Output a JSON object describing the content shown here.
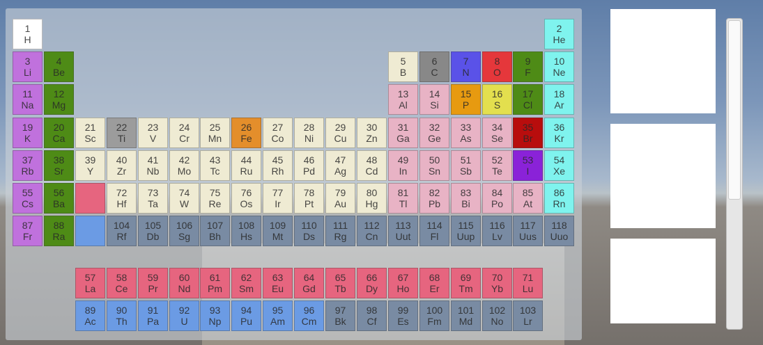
{
  "colors": {
    "nonmetal": "#ffffff",
    "noble": "#7ff3ee",
    "alkali": "#c071dd",
    "alkaline": "#4e8b16",
    "transition": "#efebd3",
    "post_transition": "#e8b3c5",
    "metalloid": "#efebd3",
    "lanthanide": "#e6657f",
    "actinide": "#6b9be4",
    "unknown": "#798ba3",
    "carbon": "#888888",
    "titanium": "#9c9c9c",
    "nitrogen": "#5a52e8",
    "oxygen": "#e5373b",
    "fluorine": "#4e8b16",
    "chlorine": "#4e8b16",
    "phosphorus": "#e79a10",
    "sulfur": "#e3df4e",
    "iron": "#e48e2b",
    "bromine": "#b80d0d",
    "iodine": "#8a22d8"
  },
  "elements": [
    {
      "n": "1",
      "s": "H",
      "r": 1,
      "c": 1,
      "k": "nonmetal"
    },
    {
      "n": "2",
      "s": "He",
      "r": 1,
      "c": 18,
      "k": "noble"
    },
    {
      "n": "3",
      "s": "Li",
      "r": 2,
      "c": 1,
      "k": "alkali"
    },
    {
      "n": "4",
      "s": "Be",
      "r": 2,
      "c": 2,
      "k": "alkaline"
    },
    {
      "n": "5",
      "s": "B",
      "r": 2,
      "c": 13,
      "k": "metalloid"
    },
    {
      "n": "6",
      "s": "C",
      "r": 2,
      "c": 14,
      "k": "carbon"
    },
    {
      "n": "7",
      "s": "N",
      "r": 2,
      "c": 15,
      "k": "nitrogen"
    },
    {
      "n": "8",
      "s": "O",
      "r": 2,
      "c": 16,
      "k": "oxygen"
    },
    {
      "n": "9",
      "s": "F",
      "r": 2,
      "c": 17,
      "k": "fluorine"
    },
    {
      "n": "10",
      "s": "Ne",
      "r": 2,
      "c": 18,
      "k": "noble"
    },
    {
      "n": "11",
      "s": "Na",
      "r": 3,
      "c": 1,
      "k": "alkali"
    },
    {
      "n": "12",
      "s": "Mg",
      "r": 3,
      "c": 2,
      "k": "alkaline"
    },
    {
      "n": "13",
      "s": "Al",
      "r": 3,
      "c": 13,
      "k": "post_transition"
    },
    {
      "n": "14",
      "s": "Si",
      "r": 3,
      "c": 14,
      "k": "post_transition"
    },
    {
      "n": "15",
      "s": "P",
      "r": 3,
      "c": 15,
      "k": "phosphorus"
    },
    {
      "n": "16",
      "s": "S",
      "r": 3,
      "c": 16,
      "k": "sulfur"
    },
    {
      "n": "17",
      "s": "Cl",
      "r": 3,
      "c": 17,
      "k": "chlorine"
    },
    {
      "n": "18",
      "s": "Ar",
      "r": 3,
      "c": 18,
      "k": "noble"
    },
    {
      "n": "19",
      "s": "K",
      "r": 4,
      "c": 1,
      "k": "alkali"
    },
    {
      "n": "20",
      "s": "Ca",
      "r": 4,
      "c": 2,
      "k": "alkaline"
    },
    {
      "n": "21",
      "s": "Sc",
      "r": 4,
      "c": 3,
      "k": "transition"
    },
    {
      "n": "22",
      "s": "Ti",
      "r": 4,
      "c": 4,
      "k": "titanium"
    },
    {
      "n": "23",
      "s": "V",
      "r": 4,
      "c": 5,
      "k": "transition"
    },
    {
      "n": "24",
      "s": "Cr",
      "r": 4,
      "c": 6,
      "k": "transition"
    },
    {
      "n": "25",
      "s": "Mn",
      "r": 4,
      "c": 7,
      "k": "transition"
    },
    {
      "n": "26",
      "s": "Fe",
      "r": 4,
      "c": 8,
      "k": "iron"
    },
    {
      "n": "27",
      "s": "Co",
      "r": 4,
      "c": 9,
      "k": "transition"
    },
    {
      "n": "28",
      "s": "Ni",
      "r": 4,
      "c": 10,
      "k": "transition"
    },
    {
      "n": "29",
      "s": "Cu",
      "r": 4,
      "c": 11,
      "k": "transition"
    },
    {
      "n": "30",
      "s": "Zn",
      "r": 4,
      "c": 12,
      "k": "transition"
    },
    {
      "n": "31",
      "s": "Ga",
      "r": 4,
      "c": 13,
      "k": "post_transition"
    },
    {
      "n": "32",
      "s": "Ge",
      "r": 4,
      "c": 14,
      "k": "post_transition"
    },
    {
      "n": "33",
      "s": "As",
      "r": 4,
      "c": 15,
      "k": "post_transition"
    },
    {
      "n": "34",
      "s": "Se",
      "r": 4,
      "c": 16,
      "k": "post_transition"
    },
    {
      "n": "35",
      "s": "Br",
      "r": 4,
      "c": 17,
      "k": "bromine"
    },
    {
      "n": "36",
      "s": "Kr",
      "r": 4,
      "c": 18,
      "k": "noble"
    },
    {
      "n": "37",
      "s": "Rb",
      "r": 5,
      "c": 1,
      "k": "alkali"
    },
    {
      "n": "38",
      "s": "Sr",
      "r": 5,
      "c": 2,
      "k": "alkaline"
    },
    {
      "n": "39",
      "s": "Y",
      "r": 5,
      "c": 3,
      "k": "transition"
    },
    {
      "n": "40",
      "s": "Zr",
      "r": 5,
      "c": 4,
      "k": "transition"
    },
    {
      "n": "41",
      "s": "Nb",
      "r": 5,
      "c": 5,
      "k": "transition"
    },
    {
      "n": "42",
      "s": "Mo",
      "r": 5,
      "c": 6,
      "k": "transition"
    },
    {
      "n": "43",
      "s": "Tc",
      "r": 5,
      "c": 7,
      "k": "transition"
    },
    {
      "n": "44",
      "s": "Ru",
      "r": 5,
      "c": 8,
      "k": "transition"
    },
    {
      "n": "45",
      "s": "Rh",
      "r": 5,
      "c": 9,
      "k": "transition"
    },
    {
      "n": "46",
      "s": "Pd",
      "r": 5,
      "c": 10,
      "k": "transition"
    },
    {
      "n": "47",
      "s": "Ag",
      "r": 5,
      "c": 11,
      "k": "transition"
    },
    {
      "n": "48",
      "s": "Cd",
      "r": 5,
      "c": 12,
      "k": "transition"
    },
    {
      "n": "49",
      "s": "In",
      "r": 5,
      "c": 13,
      "k": "post_transition"
    },
    {
      "n": "50",
      "s": "Sn",
      "r": 5,
      "c": 14,
      "k": "post_transition"
    },
    {
      "n": "51",
      "s": "Sb",
      "r": 5,
      "c": 15,
      "k": "post_transition"
    },
    {
      "n": "52",
      "s": "Te",
      "r": 5,
      "c": 16,
      "k": "post_transition"
    },
    {
      "n": "53",
      "s": "I",
      "r": 5,
      "c": 17,
      "k": "iodine"
    },
    {
      "n": "54",
      "s": "Xe",
      "r": 5,
      "c": 18,
      "k": "noble"
    },
    {
      "n": "55",
      "s": "Cs",
      "r": 6,
      "c": 1,
      "k": "alkali"
    },
    {
      "n": "56",
      "s": "Ba",
      "r": 6,
      "c": 2,
      "k": "alkaline"
    },
    {
      "n": "",
      "s": "",
      "r": 6,
      "c": 3,
      "k": "lanthanide"
    },
    {
      "n": "72",
      "s": "Hf",
      "r": 6,
      "c": 4,
      "k": "transition"
    },
    {
      "n": "73",
      "s": "Ta",
      "r": 6,
      "c": 5,
      "k": "transition"
    },
    {
      "n": "74",
      "s": "W",
      "r": 6,
      "c": 6,
      "k": "transition"
    },
    {
      "n": "75",
      "s": "Re",
      "r": 6,
      "c": 7,
      "k": "transition"
    },
    {
      "n": "76",
      "s": "Os",
      "r": 6,
      "c": 8,
      "k": "transition"
    },
    {
      "n": "77",
      "s": "Ir",
      "r": 6,
      "c": 9,
      "k": "transition"
    },
    {
      "n": "78",
      "s": "Pt",
      "r": 6,
      "c": 10,
      "k": "transition"
    },
    {
      "n": "79",
      "s": "Au",
      "r": 6,
      "c": 11,
      "k": "transition"
    },
    {
      "n": "80",
      "s": "Hg",
      "r": 6,
      "c": 12,
      "k": "transition"
    },
    {
      "n": "81",
      "s": "Tl",
      "r": 6,
      "c": 13,
      "k": "post_transition"
    },
    {
      "n": "82",
      "s": "Pb",
      "r": 6,
      "c": 14,
      "k": "post_transition"
    },
    {
      "n": "83",
      "s": "Bi",
      "r": 6,
      "c": 15,
      "k": "post_transition"
    },
    {
      "n": "84",
      "s": "Po",
      "r": 6,
      "c": 16,
      "k": "post_transition"
    },
    {
      "n": "85",
      "s": "At",
      "r": 6,
      "c": 17,
      "k": "post_transition"
    },
    {
      "n": "86",
      "s": "Rn",
      "r": 6,
      "c": 18,
      "k": "noble"
    },
    {
      "n": "87",
      "s": "Fr",
      "r": 7,
      "c": 1,
      "k": "alkali"
    },
    {
      "n": "88",
      "s": "Ra",
      "r": 7,
      "c": 2,
      "k": "alkaline"
    },
    {
      "n": "",
      "s": "",
      "r": 7,
      "c": 3,
      "k": "actinide"
    },
    {
      "n": "104",
      "s": "Rf",
      "r": 7,
      "c": 4,
      "k": "unknown"
    },
    {
      "n": "105",
      "s": "Db",
      "r": 7,
      "c": 5,
      "k": "unknown"
    },
    {
      "n": "106",
      "s": "Sg",
      "r": 7,
      "c": 6,
      "k": "unknown"
    },
    {
      "n": "107",
      "s": "Bh",
      "r": 7,
      "c": 7,
      "k": "unknown"
    },
    {
      "n": "108",
      "s": "Hs",
      "r": 7,
      "c": 8,
      "k": "unknown"
    },
    {
      "n": "109",
      "s": "Mt",
      "r": 7,
      "c": 9,
      "k": "unknown"
    },
    {
      "n": "110",
      "s": "Ds",
      "r": 7,
      "c": 10,
      "k": "unknown"
    },
    {
      "n": "111",
      "s": "Rg",
      "r": 7,
      "c": 11,
      "k": "unknown"
    },
    {
      "n": "112",
      "s": "Cn",
      "r": 7,
      "c": 12,
      "k": "unknown"
    },
    {
      "n": "113",
      "s": "Uut",
      "r": 7,
      "c": 13,
      "k": "unknown"
    },
    {
      "n": "114",
      "s": "Fl",
      "r": 7,
      "c": 14,
      "k": "unknown"
    },
    {
      "n": "115",
      "s": "Uup",
      "r": 7,
      "c": 15,
      "k": "unknown"
    },
    {
      "n": "116",
      "s": "Lv",
      "r": 7,
      "c": 16,
      "k": "unknown"
    },
    {
      "n": "117",
      "s": "Uus",
      "r": 7,
      "c": 17,
      "k": "unknown"
    },
    {
      "n": "118",
      "s": "Uuo",
      "r": 7,
      "c": 18,
      "k": "unknown"
    },
    {
      "n": "57",
      "s": "La",
      "r": 9,
      "c": 3,
      "k": "lanthanide"
    },
    {
      "n": "58",
      "s": "Ce",
      "r": 9,
      "c": 4,
      "k": "lanthanide"
    },
    {
      "n": "59",
      "s": "Pr",
      "r": 9,
      "c": 5,
      "k": "lanthanide"
    },
    {
      "n": "60",
      "s": "Nd",
      "r": 9,
      "c": 6,
      "k": "lanthanide"
    },
    {
      "n": "61",
      "s": "Pm",
      "r": 9,
      "c": 7,
      "k": "lanthanide"
    },
    {
      "n": "62",
      "s": "Sm",
      "r": 9,
      "c": 8,
      "k": "lanthanide"
    },
    {
      "n": "63",
      "s": "Eu",
      "r": 9,
      "c": 9,
      "k": "lanthanide"
    },
    {
      "n": "64",
      "s": "Gd",
      "r": 9,
      "c": 10,
      "k": "lanthanide"
    },
    {
      "n": "65",
      "s": "Tb",
      "r": 9,
      "c": 11,
      "k": "lanthanide"
    },
    {
      "n": "66",
      "s": "Dy",
      "r": 9,
      "c": 12,
      "k": "lanthanide"
    },
    {
      "n": "67",
      "s": "Ho",
      "r": 9,
      "c": 13,
      "k": "lanthanide"
    },
    {
      "n": "68",
      "s": "Er",
      "r": 9,
      "c": 14,
      "k": "lanthanide"
    },
    {
      "n": "69",
      "s": "Tm",
      "r": 9,
      "c": 15,
      "k": "lanthanide"
    },
    {
      "n": "70",
      "s": "Yb",
      "r": 9,
      "c": 16,
      "k": "lanthanide"
    },
    {
      "n": "71",
      "s": "Lu",
      "r": 9,
      "c": 17,
      "k": "lanthanide"
    },
    {
      "n": "89",
      "s": "Ac",
      "r": 10,
      "c": 3,
      "k": "actinide"
    },
    {
      "n": "90",
      "s": "Th",
      "r": 10,
      "c": 4,
      "k": "actinide"
    },
    {
      "n": "91",
      "s": "Pa",
      "r": 10,
      "c": 5,
      "k": "actinide"
    },
    {
      "n": "92",
      "s": "U",
      "r": 10,
      "c": 6,
      "k": "actinide"
    },
    {
      "n": "93",
      "s": "Np",
      "r": 10,
      "c": 7,
      "k": "actinide"
    },
    {
      "n": "94",
      "s": "Pu",
      "r": 10,
      "c": 8,
      "k": "actinide"
    },
    {
      "n": "95",
      "s": "Am",
      "r": 10,
      "c": 9,
      "k": "actinide"
    },
    {
      "n": "96",
      "s": "Cm",
      "r": 10,
      "c": 10,
      "k": "actinide"
    },
    {
      "n": "97",
      "s": "Bk",
      "r": 10,
      "c": 11,
      "k": "unknown"
    },
    {
      "n": "98",
      "s": "Cf",
      "r": 10,
      "c": 12,
      "k": "unknown"
    },
    {
      "n": "99",
      "s": "Es",
      "r": 10,
      "c": 13,
      "k": "unknown"
    },
    {
      "n": "100",
      "s": "Fm",
      "r": 10,
      "c": 14,
      "k": "unknown"
    },
    {
      "n": "101",
      "s": "Md",
      "r": 10,
      "c": 15,
      "k": "unknown"
    },
    {
      "n": "102",
      "s": "No",
      "r": 10,
      "c": 16,
      "k": "unknown"
    },
    {
      "n": "103",
      "s": "Lr",
      "r": 10,
      "c": 17,
      "k": "unknown"
    }
  ]
}
